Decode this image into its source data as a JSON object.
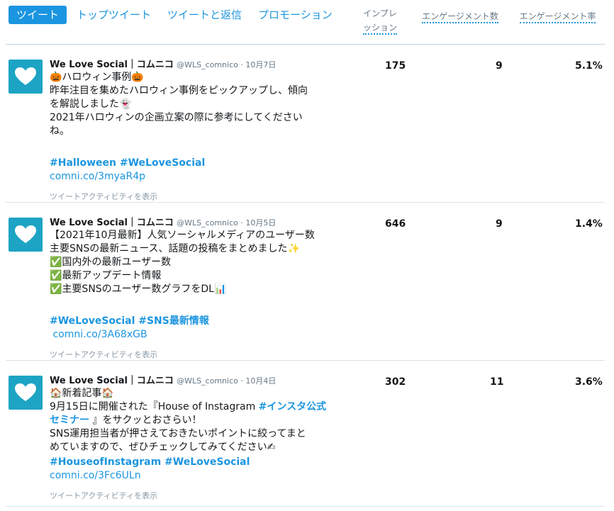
{
  "tabs": [
    {
      "label": "ツイート",
      "active": true
    },
    {
      "label": "トップツイート",
      "active": false
    },
    {
      "label": "ツイートと返信",
      "active": false
    },
    {
      "label": "プロモーション",
      "active": false
    }
  ],
  "columns": {
    "impressions_line1": "インプレ",
    "impressions_line2": "ッション",
    "engagements": "エンゲージメント数",
    "engagement_rate": "エンゲージメント率"
  },
  "tweets": [
    {
      "name": "We Love Social｜コムニコ",
      "handle": "@WLS_comnico · 10月7日",
      "line1": "🎃ハロウィン事例🎃",
      "line2": "昨年注目を集めたハロウィン事例をピックアップし、傾向",
      "line3": "を解説しました👻",
      "line4": "2021年ハロウィンの企画立案の際に参考にしてください",
      "line5": "ね。",
      "hashtags": "#Halloween #WeLoveSocial",
      "link": "comni.co/3myaR4p",
      "activity": "ツイートアクティビティを表示",
      "impressions": "175",
      "engagements": "9",
      "rate": "5.1%"
    },
    {
      "name": "We Love Social｜コムニコ",
      "handle": "@WLS_comnico · 10月5日",
      "line1": "【2021年10月最新】人気ソーシャルメディアのユーザー数",
      "line2": "主要SNSの最新ニュース、話題の投稿をまとめました✨",
      "line3": "✅国内外の最新ユーザー数",
      "line4": "✅最新アップデート情報",
      "line5": "✅主要SNSのユーザー数グラフをDL📊",
      "hashtags": "#WeLoveSocial #SNS最新情報",
      "link": " comni.co/3A68xGB",
      "activity": "ツイートアクティビティを表示",
      "impressions": "646",
      "engagements": "9",
      "rate": "1.4%"
    },
    {
      "name": "We Love Social｜コムニコ",
      "handle": "@WLS_comnico · 10月4日",
      "line1": "🏠新着記事🏠",
      "line2a": "9月15日に開催された『House of Instagram ",
      "line2b": "#インスタ公式",
      "line3a": "セミナー",
      "line3b": " 』をサクッとおさらい！",
      "line4": "SNS運用担当者が押さえておきたいポイントに絞ってまと",
      "line5": "めていますので、ぜひチェックしてみてください✍",
      "hashtags": "#HouseofInstagram #WeLoveSocial",
      "link": "comni.co/3Fc6ULn",
      "activity": "ツイートアクティビティを表示",
      "impressions": "302",
      "engagements": "11",
      "rate": "3.6%"
    }
  ]
}
